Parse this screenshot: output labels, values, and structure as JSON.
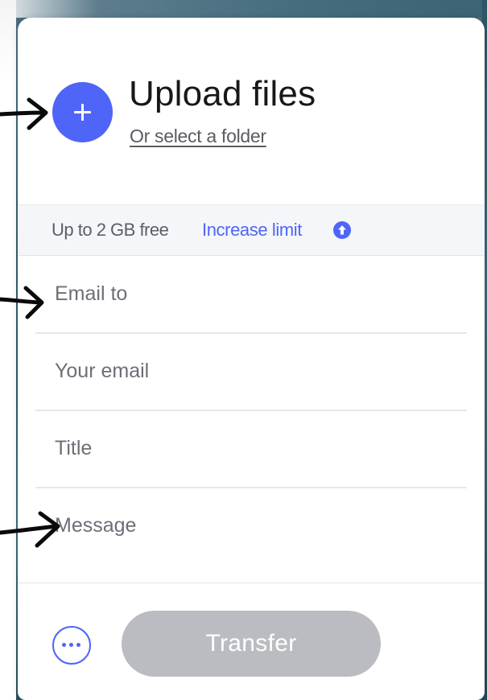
{
  "upload": {
    "title": "Upload files",
    "folder_link": "Or select a folder",
    "add_icon": "plus-icon"
  },
  "limit": {
    "text": "Up to 2 GB free",
    "increase_link": "Increase limit",
    "increase_icon": "arrow-up-circle-icon"
  },
  "form": {
    "email_to_placeholder": "Email to",
    "your_email_placeholder": "Your email",
    "title_placeholder": "Title",
    "message_placeholder": "Message"
  },
  "footer": {
    "more_icon": "ellipsis-circle-icon",
    "transfer_label": "Transfer"
  },
  "colors": {
    "accent": "#4f65f7",
    "disabled_button": "#bbbcc1"
  }
}
